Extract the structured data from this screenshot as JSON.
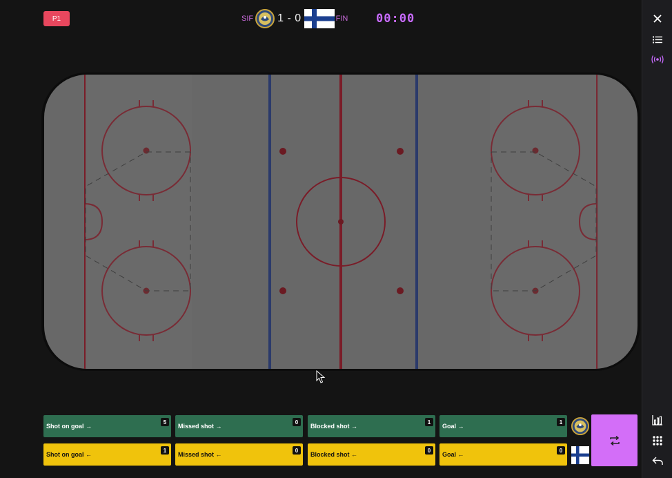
{
  "header": {
    "period": "P1",
    "home_code": "SIF",
    "score": "1 - 0",
    "away_code": "FIN",
    "clock": "00:00"
  },
  "sidebar": {
    "icons": [
      "close-icon",
      "list-icon",
      "broadcast-icon",
      "bar-chart-icon",
      "grid-dots-icon",
      "undo-icon"
    ]
  },
  "stats": {
    "home": [
      {
        "label": "Shot on goal →",
        "count": "5"
      },
      {
        "label": "Missed shot →",
        "count": "0"
      },
      {
        "label": "Blocked shot →",
        "count": "1"
      },
      {
        "label": "Goal →",
        "count": "1"
      }
    ],
    "away": [
      {
        "label": "Shot on goal ←",
        "count": "1"
      },
      {
        "label": "Missed shot ←",
        "count": "0"
      },
      {
        "label": "Blocked shot ←",
        "count": "0"
      },
      {
        "label": "Goal ←",
        "count": "0"
      }
    ]
  },
  "colors": {
    "home_button": "#2e6e50",
    "away_button": "#f0c30c",
    "period_badge": "#e8475e",
    "swap_button": "#d36ef8",
    "clock": "#c86bff",
    "rink_surface": "#686868",
    "red_line": "#7a1c28",
    "blue_line": "#2b3a6b"
  }
}
